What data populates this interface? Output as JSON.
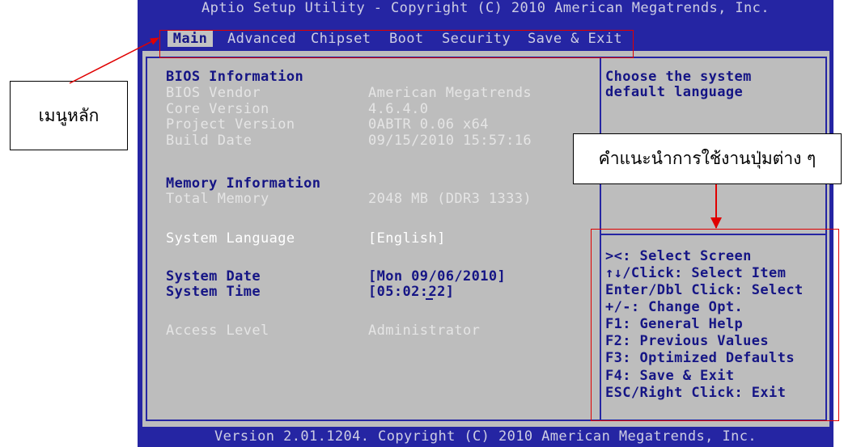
{
  "header": {
    "title": "Aptio Setup Utility - Copyright (C) 2010 American Megatrends, Inc.",
    "tabs": [
      {
        "label": "Main",
        "active": true
      },
      {
        "label": "Advanced"
      },
      {
        "label": "Chipset"
      },
      {
        "label": "Boot"
      },
      {
        "label": "Security"
      },
      {
        "label": "Save & Exit"
      }
    ]
  },
  "main": {
    "bios_information": {
      "heading": "BIOS Information",
      "items": [
        {
          "label": "BIOS Vendor",
          "value": "American Megatrends"
        },
        {
          "label": "Core Version",
          "value": "4.6.4.0"
        },
        {
          "label": "Project Version",
          "value": "0ABTR 0.06 x64"
        },
        {
          "label": "Build Date",
          "value": "09/15/2010 15:57:16"
        }
      ]
    },
    "memory_information": {
      "heading": "Memory Information",
      "items": [
        {
          "label": "Total Memory",
          "value": "2048 MB (DDR3 1333)"
        }
      ]
    },
    "system_language": {
      "label": "System Language",
      "value": "[English]",
      "selected": true
    },
    "system_date": {
      "label": "System Date",
      "value": "[Mon 09/06/2010]"
    },
    "system_time": {
      "label": "System Time",
      "value": "[05:02:22]"
    },
    "access_level": {
      "label": "Access Level",
      "value": "Administrator"
    }
  },
  "help": {
    "description": [
      "Choose the system",
      "default language"
    ],
    "keys": [
      "><: Select Screen",
      "↑↓/Click: Select Item",
      "Enter/Dbl Click: Select",
      "+/-: Change Opt.",
      "F1: General Help",
      "F2: Previous Values",
      "F3: Optimized Defaults",
      "F4: Save & Exit",
      "ESC/Right Click: Exit"
    ]
  },
  "footer": "Version 2.01.1204. Copyright (C) 2010 American Megatrends, Inc.",
  "annotations": {
    "main_menu_label": "เมนูหลัก",
    "key_help_label": "คำแนะนำการใช้งานปุ่มต่าง ๆ"
  },
  "colors": {
    "bios_blue": "#2525a3",
    "panel_gray": "#bdbdbd",
    "tab_selected_bg": "#c2c2c2",
    "text_dark": "#151585",
    "text_light": "#e5e5e5",
    "text_header": "#cdcde3",
    "annotation_red": "#e00000"
  }
}
